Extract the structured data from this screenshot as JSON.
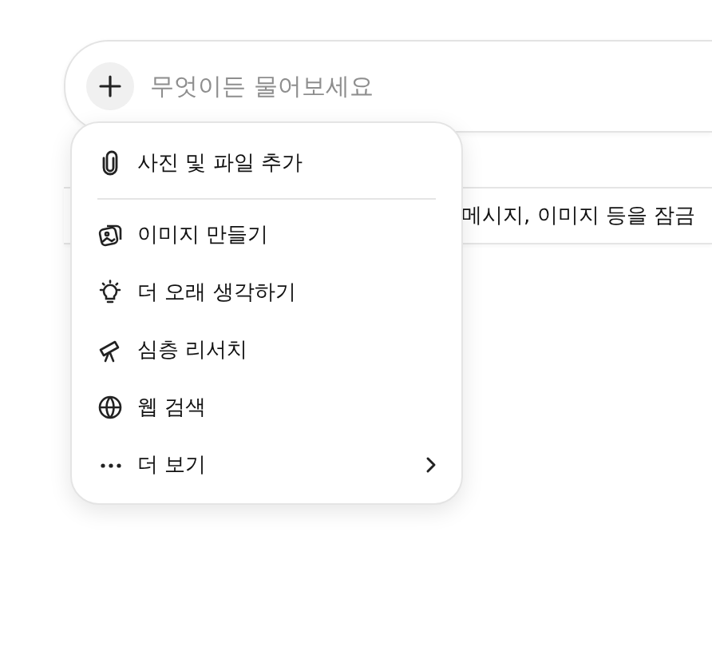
{
  "composer": {
    "placeholder": "무엇이든 물어보세요"
  },
  "banner": {
    "text": "메시지, 이미지 등을 잠금"
  },
  "menu": {
    "items": [
      {
        "kind": "attach",
        "label": "사진 및 파일 추가",
        "divider_after": true,
        "submenu": false
      },
      {
        "kind": "image",
        "label": "이미지 만들기",
        "divider_after": false,
        "submenu": false
      },
      {
        "kind": "think",
        "label": "더 오래 생각하기",
        "divider_after": false,
        "submenu": false
      },
      {
        "kind": "research",
        "label": "심층 리서치",
        "divider_after": false,
        "submenu": false
      },
      {
        "kind": "web",
        "label": "웹 검색",
        "divider_after": false,
        "submenu": false
      },
      {
        "kind": "more",
        "label": "더 보기",
        "divider_after": false,
        "submenu": true
      }
    ]
  }
}
